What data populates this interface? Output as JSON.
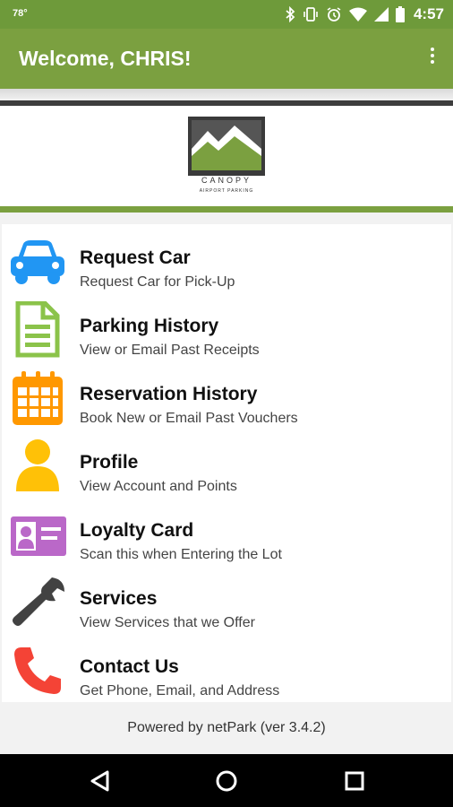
{
  "status_bar": {
    "temperature": "78°",
    "time": "4:57",
    "icons": [
      "bluetooth-icon",
      "vibrate-icon",
      "alarm-icon",
      "wifi-icon",
      "signal-icon",
      "battery-icon"
    ]
  },
  "app_bar": {
    "title": "Welcome, CHRIS!",
    "overflow_icon": "more-vert-icon"
  },
  "logo": {
    "word": "CANOPY",
    "subtitle": "AIRPORT PARKING"
  },
  "menu": {
    "items": [
      {
        "label": "Request Car",
        "subtitle": "Request Car for Pick-Up",
        "icon": "car-icon",
        "color": "#2196f3"
      },
      {
        "label": "Parking History",
        "subtitle": "View or Email Past Receipts",
        "icon": "document-icon",
        "color": "#8bc34a"
      },
      {
        "label": "Reservation History",
        "subtitle": "Book New or Email Past Vouchers",
        "icon": "calendar-icon",
        "color": "#ff9800"
      },
      {
        "label": "Profile",
        "subtitle": "View Account and Points",
        "icon": "person-icon",
        "color": "#ffc107"
      },
      {
        "label": "Loyalty Card",
        "subtitle": "Scan this when Entering the Lot",
        "icon": "id-card-icon",
        "color": "#ba68c8"
      },
      {
        "label": "Services",
        "subtitle": "View Services that we Offer",
        "icon": "wrench-icon",
        "color": "#424242"
      },
      {
        "label": "Contact Us",
        "subtitle": "Get Phone, Email, and Address",
        "icon": "phone-icon",
        "color": "#f44336"
      }
    ]
  },
  "footer": {
    "powered_by": "Powered by netPark (ver 3.4.2)"
  },
  "colors": {
    "primary": "#7ba040",
    "status_bar": "#6e9a3a"
  }
}
